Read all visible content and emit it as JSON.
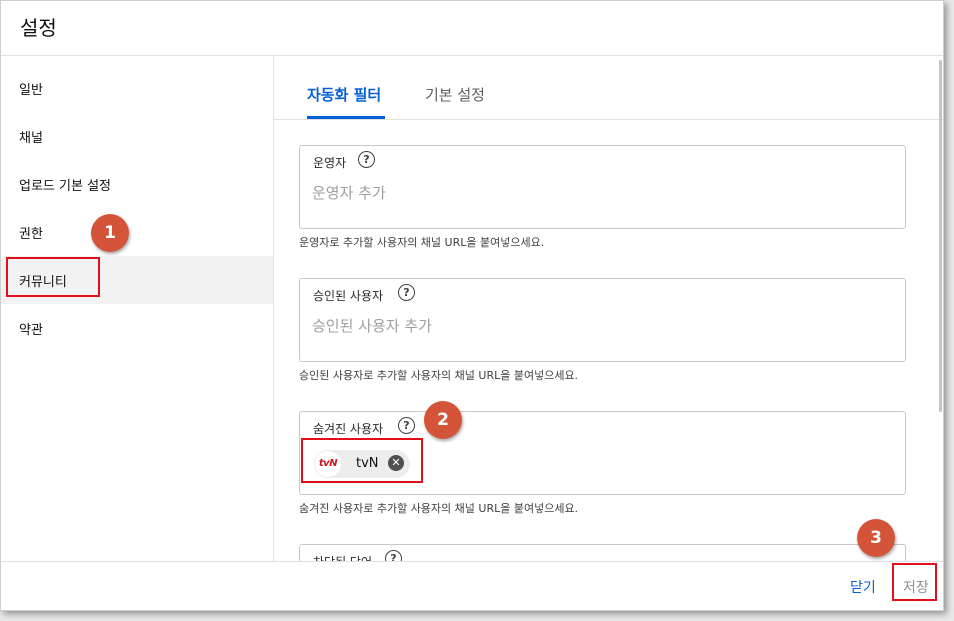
{
  "dialog": {
    "title": "설정",
    "sidebar": {
      "items": [
        {
          "label": "일반"
        },
        {
          "label": "채널"
        },
        {
          "label": "업로드 기본 설정"
        },
        {
          "label": "권한"
        },
        {
          "label": "커뮤니티",
          "active": true
        },
        {
          "label": "약관"
        }
      ]
    },
    "tabs": [
      {
        "label": "자동화 필터",
        "active": true
      },
      {
        "label": "기본 설정"
      }
    ],
    "fields": {
      "moderators": {
        "label": "운영자",
        "placeholder": "운영자 추가",
        "hint": "운영자로 추가할 사용자의 채널 URL을 붙여넣으세요."
      },
      "approved": {
        "label": "승인된 사용자",
        "placeholder": "승인된 사용자 추가",
        "hint": "승인된 사용자로 추가할 사용자의 채널 URL을 붙여넣으세요."
      },
      "hidden": {
        "label": "숨겨진 사용자",
        "chip": {
          "logo": "tvN",
          "label": "tvN"
        },
        "hint": "숨겨진 사용자로 추가할 사용자의 채널 URL을 붙여넣으세요."
      },
      "blocked": {
        "label": "차단된 단어"
      }
    },
    "footer": {
      "close_label": "닫기",
      "save_label": "저장"
    }
  },
  "annotations": [
    "1",
    "2",
    "3"
  ],
  "colors": {
    "accent": "#065fd4",
    "highlight": "#e0101b",
    "badge": "#d4543a"
  }
}
